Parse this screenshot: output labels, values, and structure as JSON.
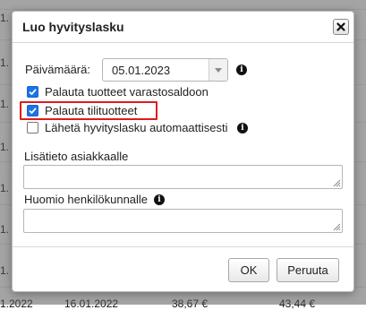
{
  "background": {
    "rows": [
      {
        "col1": "1.",
        "col2": "",
        "col3": "",
        "col4": ""
      },
      {
        "col1": "1.",
        "col2": "",
        "col3": "",
        "col4": ""
      },
      {
        "col1": "1.",
        "col2": "",
        "col3": "",
        "col4": ""
      },
      {
        "col1": "1.",
        "col2": "",
        "col3": "",
        "col4": ""
      },
      {
        "col1": "1.",
        "col2": "",
        "col3": "",
        "col4": ""
      },
      {
        "col1": "1.",
        "col2": "",
        "col3": "",
        "col4": ""
      },
      {
        "col1": "1.",
        "col2": "",
        "col3": "",
        "col4": ""
      },
      {
        "col1": "1.2022",
        "col2": "16.01.2022",
        "col3": "38,67 €",
        "col4": "43,44 €"
      }
    ]
  },
  "dialog": {
    "title": "Luo hyvityslasku",
    "date_label": "Päivämäärä:",
    "date_value": "05.01.2023",
    "checkboxes": [
      {
        "label": "Palauta tuotteet varastosaldoon",
        "checked": true
      },
      {
        "label": "Palauta tilituotteet",
        "checked": true
      },
      {
        "label": "Lähetä hyvityslasku automaattisesti",
        "checked": false
      }
    ],
    "customer_note_label": "Lisätieto asiakkaalle",
    "customer_note_value": "",
    "staff_note_label": "Huomio henkilökunnalle",
    "staff_note_value": "",
    "ok_label": "OK",
    "cancel_label": "Peruuta"
  },
  "icons": {
    "close": "close-icon",
    "info": "info-icon",
    "dropdown": "chevron-down-icon",
    "check": "check-icon",
    "resize": "resize-grip-icon"
  },
  "colors": {
    "checkbox": "#1a73e8",
    "highlight": "#e01b1b",
    "overlay": "#5a5a5a"
  }
}
